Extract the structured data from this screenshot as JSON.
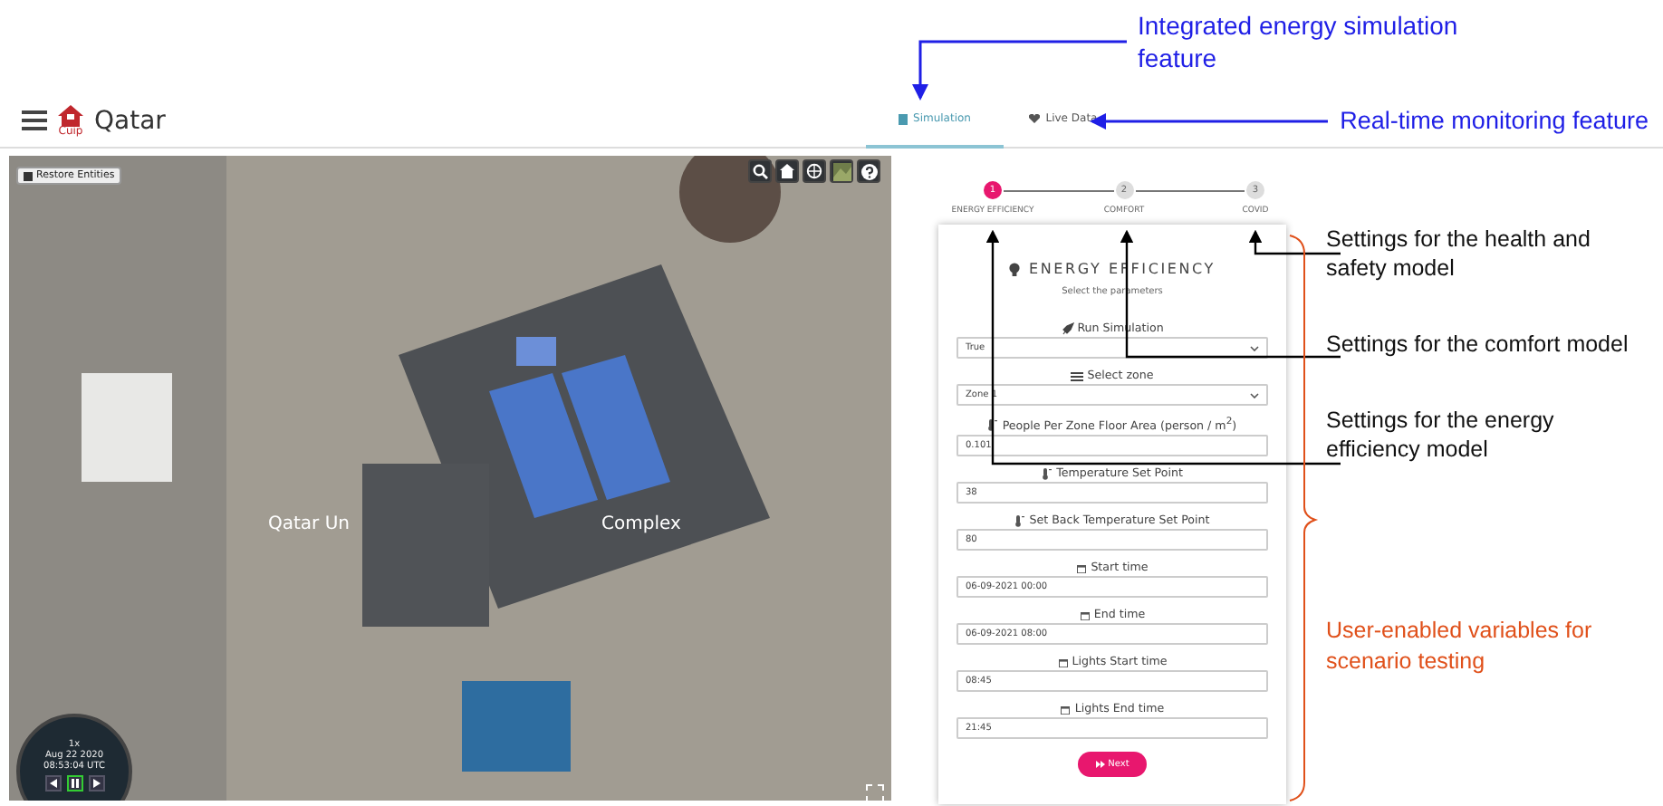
{
  "feature_callouts": [
    "Integrated energy simulation feature",
    "Real-time monitoring feature"
  ],
  "header": {
    "brand_mark": "Cuip",
    "title": "Qatar"
  },
  "tabs": [
    {
      "label": "Simulation",
      "selected": true
    },
    {
      "label": "Live Data",
      "selected": false
    }
  ],
  "map": {
    "restore_button": "Restore Entities",
    "labels": [
      "Qatar Un",
      "Complex"
    ],
    "clock": {
      "speed": "1x",
      "date": "Aug 22 2020",
      "time": "08:53:04 UTC",
      "playing": true
    }
  },
  "stepper": [
    {
      "number": "1",
      "label": "ENERGY EFFICIENCY",
      "selected": true
    },
    {
      "number": "2",
      "label": "COMFORT",
      "selected": false
    },
    {
      "number": "3",
      "label": "COVID",
      "selected": false
    }
  ],
  "form": {
    "title": "ENERGY EFFICIENCY",
    "subtitle": "Select the parameters",
    "fields": [
      {
        "kind": "toggle",
        "label": "Run Simulation",
        "value": "True"
      },
      {
        "kind": "zone",
        "label": "Select zone",
        "value": "Zone 1"
      },
      {
        "kind": "measure",
        "label": "People Per Zone Floor Area (person / m$^{2}$)",
        "value": "0.101"
      },
      {
        "kind": "measure",
        "label": "Temperature Set Point",
        "value": "38"
      },
      {
        "kind": "measure",
        "label": "Set Back Temperature Set Point",
        "value": "80"
      },
      {
        "kind": "time",
        "label": "Start time",
        "value": "06-09-2021 00:00"
      },
      {
        "kind": "time",
        "label": "End time",
        "value": "06-09-2021 08:00"
      },
      {
        "kind": "time",
        "label": "Lights Start time",
        "value": "08:45"
      },
      {
        "kind": "time",
        "label": "Lights End time",
        "value": "21:45"
      }
    ],
    "button": "Next"
  },
  "model_callouts": [
    "Settings for the health and safety model",
    "Settings for the comfort model",
    "Settings for the energy efficiency model"
  ],
  "variables_callout": "User-enabled variables for scenario testing"
}
